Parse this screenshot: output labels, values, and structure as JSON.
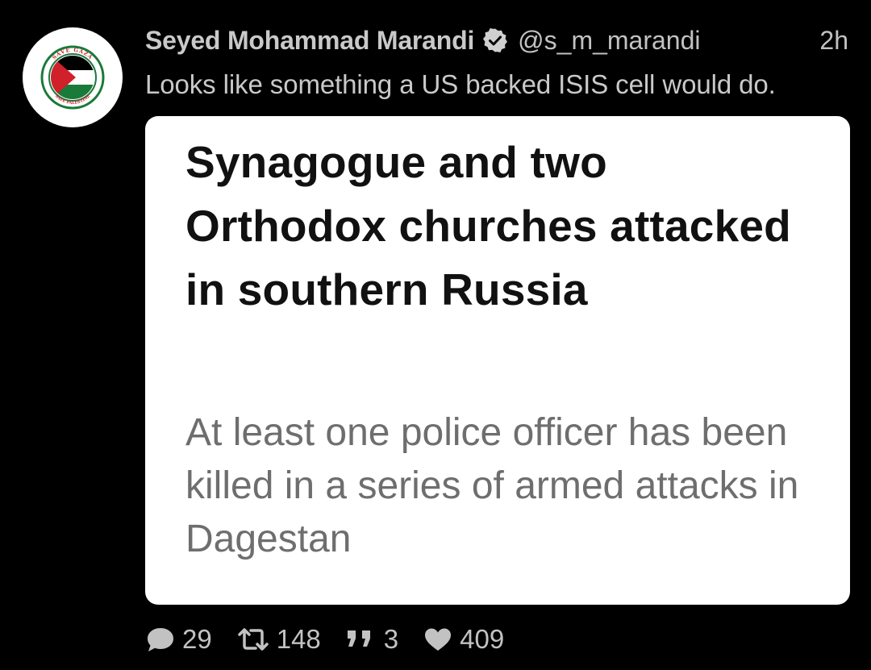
{
  "tweet": {
    "author_name": "Seyed Mohammad Marandi",
    "handle": "@s_m_marandi",
    "time": "2h",
    "text": "Looks like something a US backed ISIS cell would do.",
    "verified_icon": "verified-badge-icon",
    "avatar": {
      "top_text": "SAVE GAZA",
      "bottom_text": "SAVE PALESTINE",
      "colors": {
        "green": "#1a7a3a",
        "red": "#d0202a",
        "black": "#000000",
        "white": "#ffffff"
      }
    },
    "card": {
      "headline": "Synagogue and two Orthodox churches attacked in southern Russia",
      "subheadline": "At least one police officer has been killed in a series of armed attacks in Dagestan"
    },
    "actions": {
      "replies": "29",
      "retweets": "148",
      "quotes": "3",
      "likes": "409"
    }
  }
}
